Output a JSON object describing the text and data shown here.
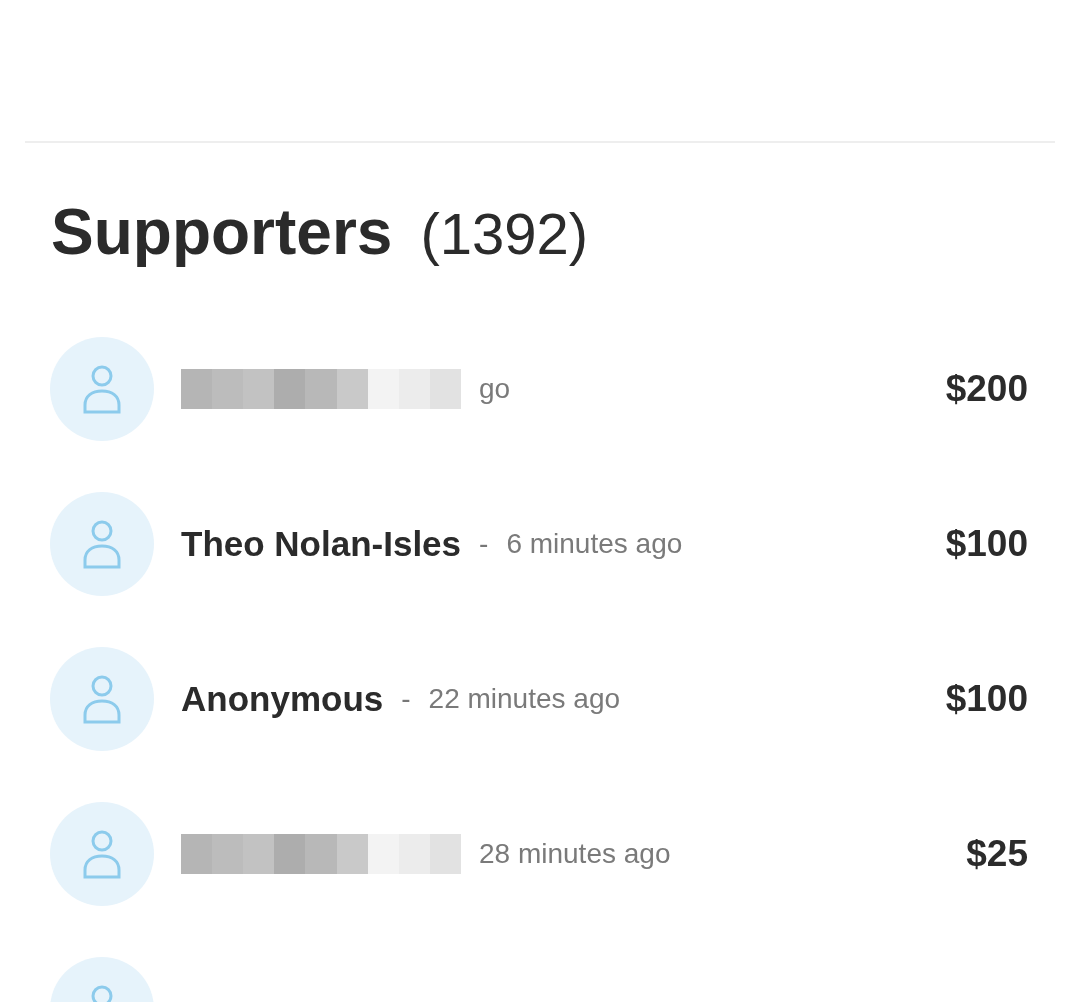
{
  "section": {
    "title": "Supporters",
    "count": "(1392)"
  },
  "supporters": [
    {
      "kind": "redacted",
      "time": "go",
      "amount": "$200"
    },
    {
      "kind": "named",
      "name": "Theo Nolan-Isles",
      "separator": "-",
      "time": "6 minutes ago",
      "amount": "$100"
    },
    {
      "kind": "named",
      "name": "Anonymous",
      "separator": "-",
      "time": "22 minutes ago",
      "amount": "$100"
    },
    {
      "kind": "redacted",
      "time": "28 minutes ago",
      "amount": "$25"
    },
    {
      "kind": "partial"
    }
  ]
}
